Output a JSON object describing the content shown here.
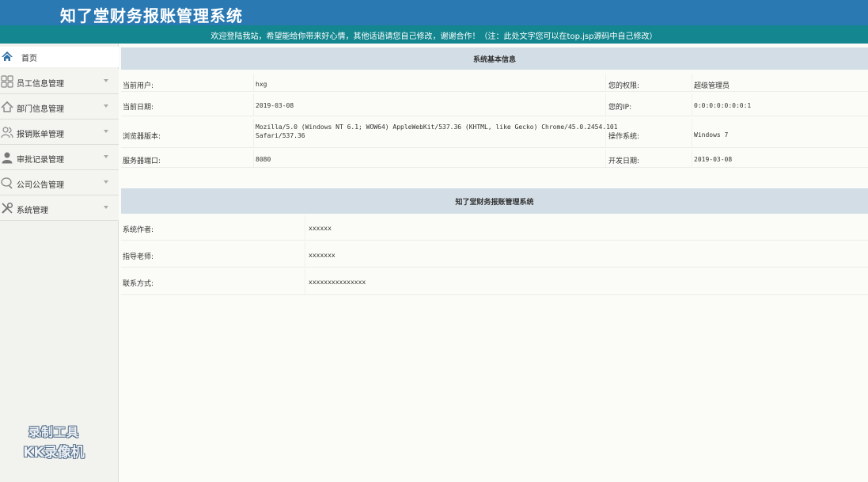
{
  "header": {
    "title": "知了堂财务报账管理系统"
  },
  "notice": {
    "text": "欢迎登陆我站，希望能给你带来好心情，其他话语请您自己修改，谢谢合作！（注：此处文字您可以在top.jsp源码中自己修改）"
  },
  "sidebar": {
    "home": {
      "label": "首页",
      "icon": "home-icon"
    },
    "items": [
      {
        "label": "员工信息管理",
        "icon": "grid-icon"
      },
      {
        "label": "部门信息管理",
        "icon": "home-outline-icon"
      },
      {
        "label": "报销账单管理",
        "icon": "users-icon"
      },
      {
        "label": "审批记录管理",
        "icon": "user-icon"
      },
      {
        "label": "公司公告管理",
        "icon": "chat-icon"
      },
      {
        "label": "系统管理",
        "icon": "tools-icon"
      }
    ]
  },
  "watermark": {
    "line1": "录制工具",
    "line2": "KK录像机"
  },
  "system_info": {
    "title": "系统基本信息",
    "current_user_label": "当前用户:",
    "current_user": "hxg",
    "role_label": "您的权限:",
    "role": "超级管理员",
    "date_label": "当前日期:",
    "date": "2019-03-08",
    "ip_label": "您的IP:",
    "ip": "0:0:0:0:0:0:0:1",
    "browser_label": "浏览器版本:",
    "browser_line1": "Mozilla/5.0 (Windows NT 6.1; WOW64) AppleWebKit/537.36 (KHTML, like Gecko) Chrome/45.0.2454.101",
    "browser_line2": "Safari/537.36",
    "os_label": "操作系统:",
    "os": "Windows 7",
    "port_label": "服务器端口:",
    "port": "8080",
    "dev_date_label": "开发日期:",
    "dev_date": "2019-03-08"
  },
  "about": {
    "title": "知了堂财务报账管理系统",
    "author_label": "系统作者:",
    "author": "xxxxxx",
    "teacher_label": "指导老师:",
    "teacher": "xxxxxxx",
    "contact_label": "联系方式:",
    "contact": "xxxxxxxxxxxxxxx"
  },
  "colors": {
    "header": "#2a79b3",
    "notice": "#13868f",
    "panel_head": "#d3dde6"
  }
}
